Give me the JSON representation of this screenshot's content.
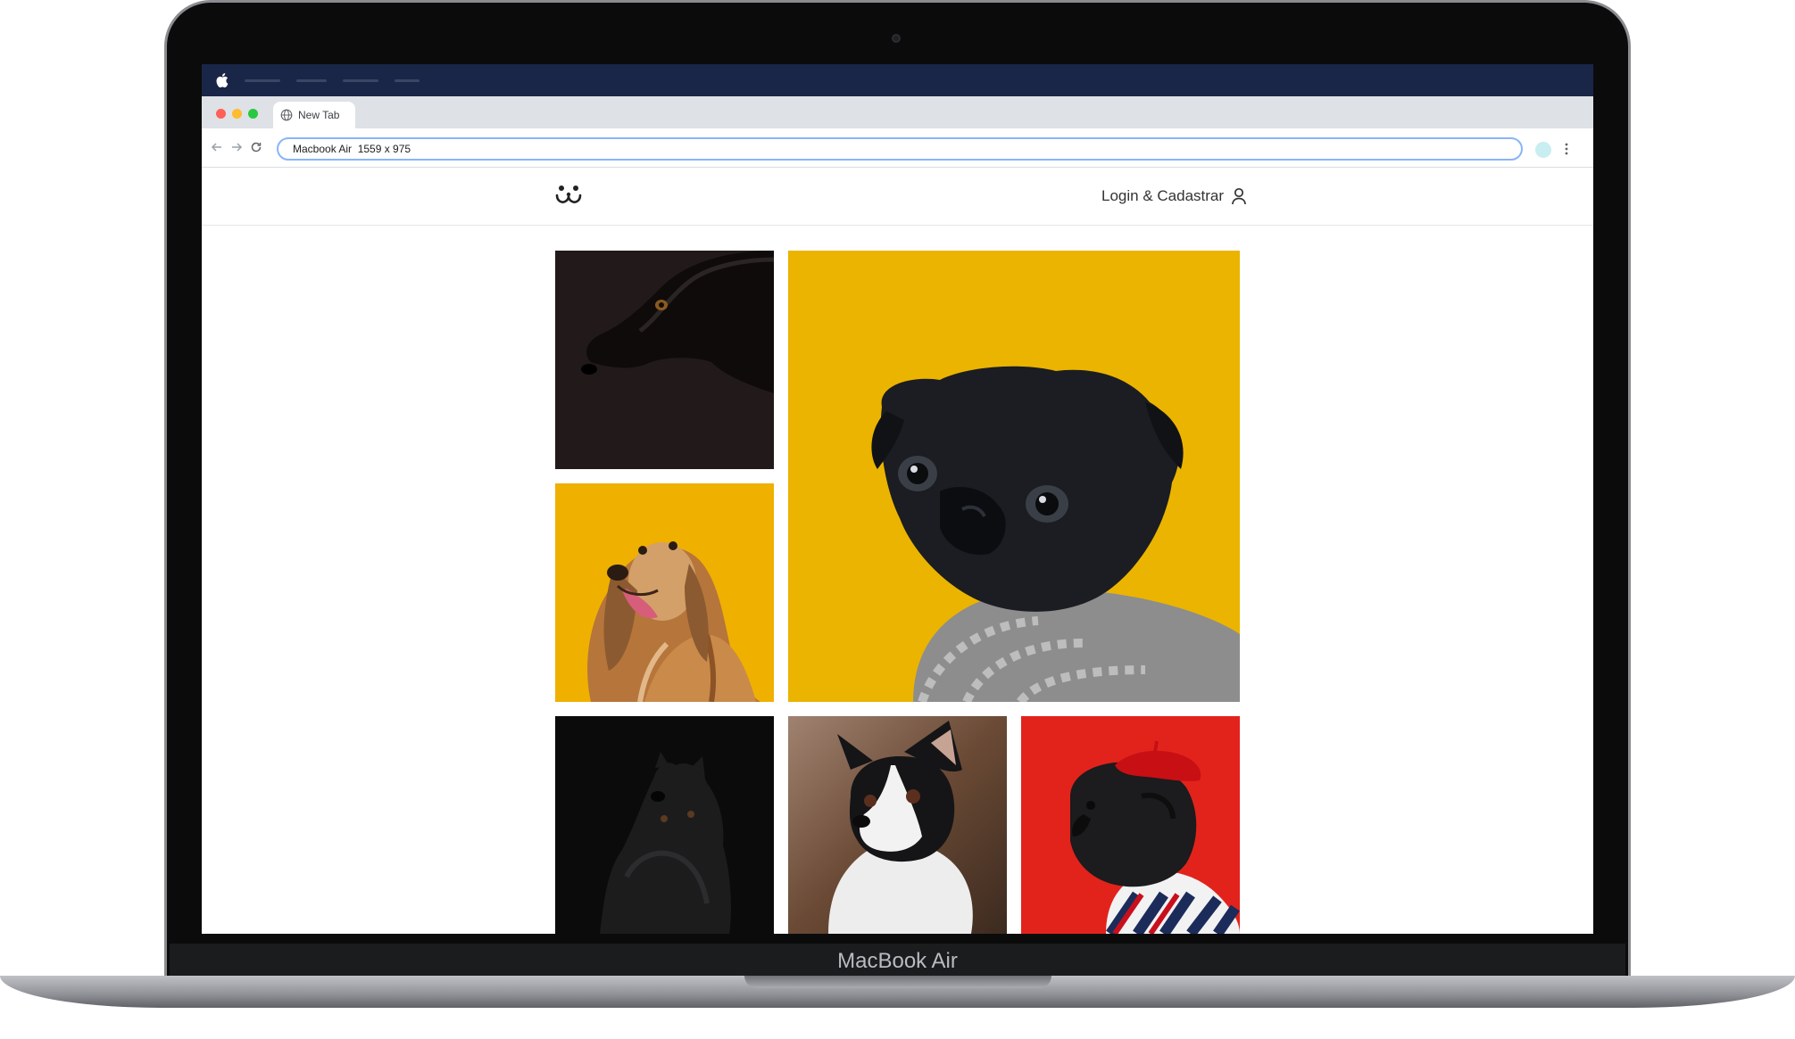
{
  "device": {
    "brand_label": "MacBook Air"
  },
  "browser": {
    "tab_title": "New Tab",
    "address": "Macbook Air  1559 x 975"
  },
  "site": {
    "login_label": "Login & Cadastrar"
  },
  "gallery": {
    "photos": [
      {
        "subject": "black dog profile",
        "background": "#221a1a"
      },
      {
        "subject": "black pug in scarf",
        "background": "#ebb400"
      },
      {
        "subject": "afghan hound",
        "background": "#f0b000"
      },
      {
        "subject": "black fluffy dog",
        "background": "#0b0b0b"
      },
      {
        "subject": "boston terrier",
        "background": "#7a5a42"
      },
      {
        "subject": "pug with red beret",
        "background": "#e2231c"
      }
    ]
  },
  "colors": {
    "menubar": "#1a2647",
    "tabbar": "#dee1e6",
    "omnibox_border": "#8ab4f8"
  }
}
